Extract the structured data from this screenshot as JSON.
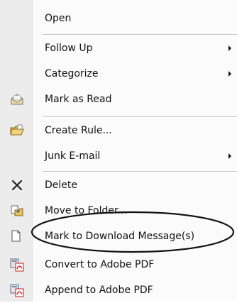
{
  "menu": {
    "items": [
      {
        "label": "Open"
      },
      {
        "label": "Follow Up"
      },
      {
        "label": "Categorize"
      },
      {
        "label": "Mark as Read"
      },
      {
        "label": "Create Rule..."
      },
      {
        "label": "Junk E-mail"
      },
      {
        "label": "Delete"
      },
      {
        "label": "Move to Folder..."
      },
      {
        "label": "Mark to Download Message(s)"
      },
      {
        "label": "Convert to Adobe PDF"
      },
      {
        "label": "Append to Adobe PDF"
      }
    ]
  },
  "icons": {
    "mark_as_read": "envelope-open-icon",
    "create_rule": "folder-rule-icon",
    "delete": "x-delete-icon",
    "move_to_folder": "move-folder-icon",
    "mark_to_download": "download-message-icon",
    "convert_pdf": "adobe-pdf-icon",
    "append_pdf": "adobe-pdf-icon"
  },
  "colors": {
    "gutter": "#ececec",
    "menu_bg": "#fbfbfb",
    "separator": "#c5c5c5",
    "highlight_oval": "#111111"
  }
}
